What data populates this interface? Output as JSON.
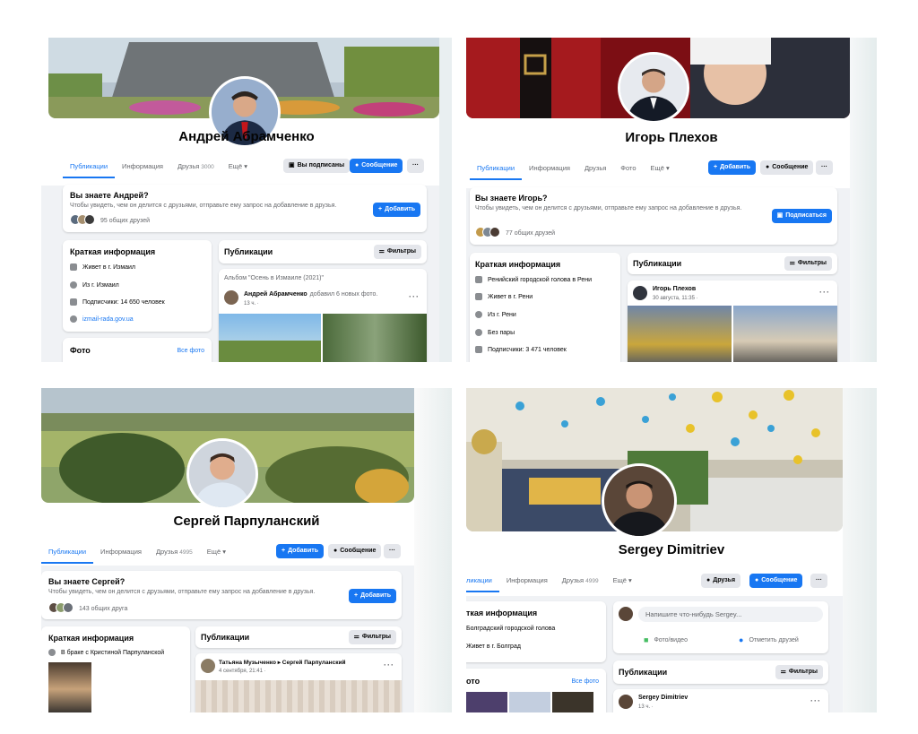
{
  "p1": {
    "name": "Андрей Абрамченко",
    "tabs": [
      "Публикации",
      "Информация",
      "Друзья",
      "Ещё ▾"
    ],
    "friends_count": "3000",
    "btn_subscribed": "Вы подписаны",
    "btn_message": "Сообщение",
    "btn_more": "···",
    "know_title": "Вы знаете Андрей?",
    "know_sub": "Чтобы увидеть, чем он делится с друзьями, отправьте ему запрос на добавление в друзья.",
    "add": "Добавить",
    "mutual": "95 общих друзей",
    "info_title": "Краткая информация",
    "info": [
      "Живет в г. Измаил",
      "Из г. Измаил",
      "Подписчики: 14 650 человек",
      "izmail-rada.gov.ua"
    ],
    "photo_title": "Фото",
    "all_photos": "Все фото",
    "pubs_title": "Публикации",
    "filters": "Фильтры",
    "album": "Альбом \"Осень в Измаиле (2021)\"",
    "post_author": "Андрей Абрамченко",
    "post_action": "добавил 6 новых фото.",
    "post_time": "13 ч. · "
  },
  "p2": {
    "name": "Игорь Плехов",
    "tabs": [
      "Публикации",
      "Информация",
      "Друзья",
      "Фото",
      "Ещё ▾"
    ],
    "btn_add": "Добавить",
    "btn_message": "Сообщение",
    "btn_more": "···",
    "know_title": "Вы знаете Игорь?",
    "know_sub": "Чтобы увидеть, чем он делится с друзьями, отправьте ему запрос на добавление в друзья.",
    "subscribe": "Подписаться",
    "mutual": "77 общих друзей",
    "info_title": "Краткая информация",
    "info": [
      "Ренийский городской голова в Рени",
      "Живет в г. Рени",
      "Из г. Рени",
      "Без пары",
      "Подписчики: 3 471 человек"
    ],
    "pubs_title": "Публикации",
    "filters": "Фильтры",
    "post_author": "Игорь Плехов",
    "post_time": "30 августа, 11:35 · "
  },
  "p3": {
    "name": "Сергей Парпуланский",
    "tabs": [
      "Публикации",
      "Информация",
      "Друзья",
      "Ещё ▾"
    ],
    "friends_count": "4995",
    "btn_add": "Добавить",
    "btn_message": "Сообщение",
    "btn_more": "···",
    "know_title": "Вы знаете Сергей?",
    "know_sub": "Чтобы увидеть, чем он делится с друзьями, отправьте ему запрос на добавление в друзья.",
    "add": "Добавить",
    "mutual": "143 общих друга",
    "info_title": "Краткая информация",
    "info": [
      "В браке с Кристиной Парпуланской"
    ],
    "pubs_title": "Публикации",
    "filters": "Фильтры",
    "post_author": "Татьяна Музыченко ▸ Сергей Парпуланский",
    "post_time": "4 сентября, 21:41 · "
  },
  "p4": {
    "name": "Sergey Dimitriev",
    "tabs": [
      "ликации",
      "Информация",
      "Друзья",
      "Ещё ▾"
    ],
    "friends_count": "4999",
    "btn_friends": "Друзья",
    "btn_message": "Сообщение",
    "btn_more": "···",
    "info_title": "ткая информация",
    "info": [
      "Болградский городской голова",
      "Живет в г. Болград"
    ],
    "photo_title": "ото",
    "all_photos": "Все фото",
    "composer": "Напишите что-нибудь Sergey...",
    "photo_video": "Фото/видео",
    "tag_friends": "Отметить друзей",
    "pubs_title": "Публикации",
    "filters": "Фильтры",
    "post_author": "Sergey Dimitriev",
    "post_time": "13 ч. · "
  }
}
